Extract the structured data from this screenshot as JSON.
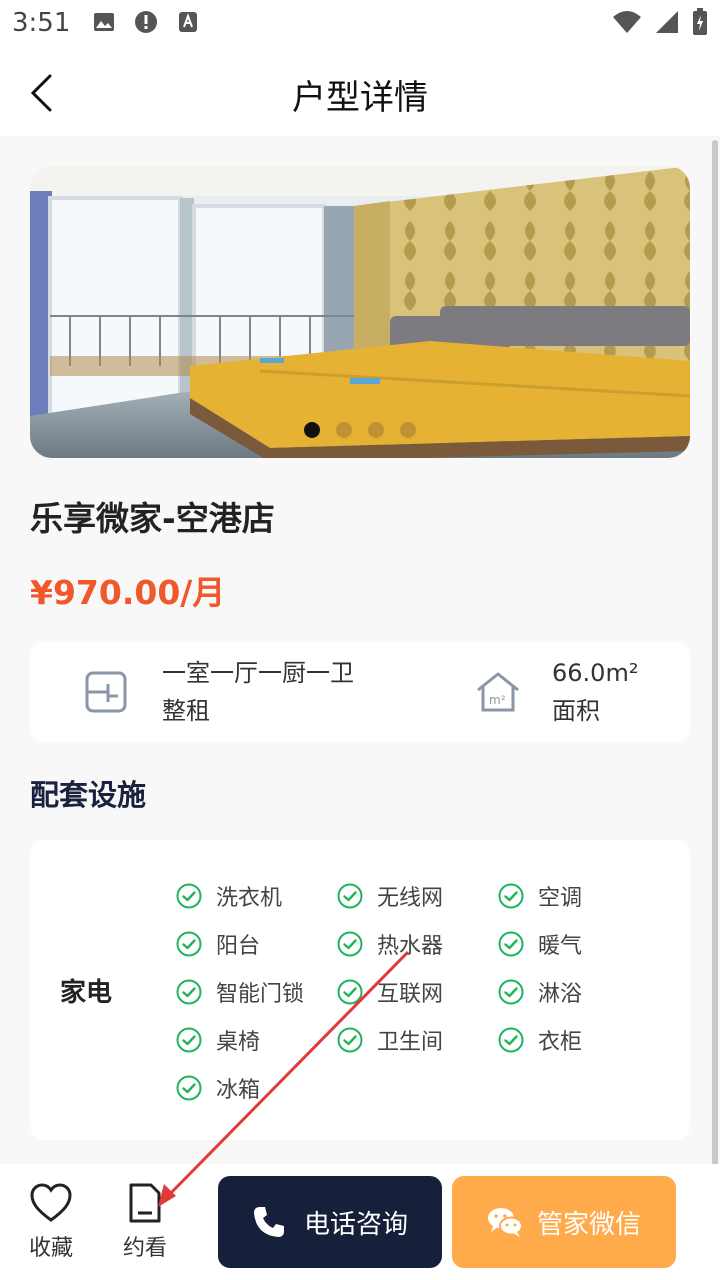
{
  "status_bar": {
    "time": "3:51"
  },
  "header": {
    "title": "户型详情"
  },
  "gallery": {
    "dot_count": 4,
    "active_index": 0
  },
  "listing": {
    "name": "乐享微家-空港店",
    "price": "¥970.00/月"
  },
  "info": {
    "layout_line1": "一室一厅一厨一卫",
    "layout_line2": "整租",
    "area_value": "66.0m²",
    "area_label": "面积"
  },
  "facilities": {
    "section_title": "配套设施",
    "category": "家电",
    "items": [
      "洗衣机",
      "无线网",
      "空调",
      "阳台",
      "热水器",
      "暖气",
      "智能门锁",
      "互联网",
      "淋浴",
      "桌椅",
      "卫生间",
      "衣柜",
      "冰箱"
    ]
  },
  "bottom_bar": {
    "favorite_label": "收藏",
    "appointment_label": "约看",
    "phone_label": "电话咨询",
    "wechat_label": "管家微信"
  },
  "colors": {
    "price": "#f0572a",
    "dark_button": "#16203a",
    "orange_button": "#ffab4c",
    "check": "#1fb45a",
    "annotation": "#e03a3a"
  }
}
